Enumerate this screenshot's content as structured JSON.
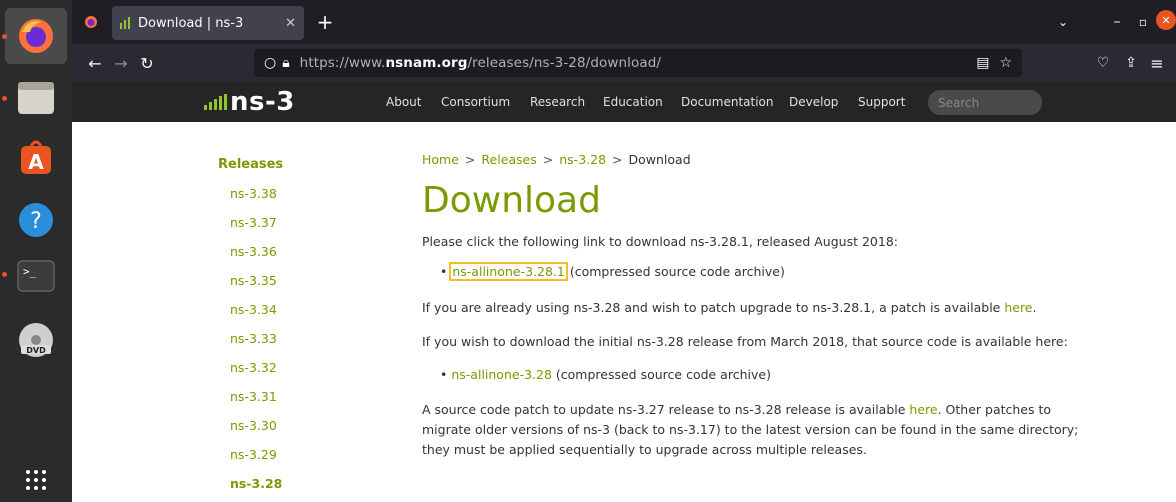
{
  "browser": {
    "tab_title": "Download | ns-3",
    "url_prefix": "https://www.",
    "url_domain": "nsnam.org",
    "url_path": "/releases/ns-3-28/download/"
  },
  "site": {
    "logo_text": "ns-3",
    "nav": [
      "About",
      "Consortium",
      "Research",
      "Education",
      "Documentation",
      "Develop",
      "Support"
    ],
    "search_placeholder": "Search"
  },
  "sidebar": {
    "heading": "Releases",
    "items": [
      "ns-3.38",
      "ns-3.37",
      "ns-3.36",
      "ns-3.35",
      "ns-3.34",
      "ns-3.33",
      "ns-3.32",
      "ns-3.31",
      "ns-3.30",
      "ns-3.29",
      "ns-3.28"
    ]
  },
  "breadcrumb": {
    "home": "Home",
    "releases": "Releases",
    "version": "ns-3.28",
    "current": "Download",
    "separator": ">"
  },
  "main": {
    "title": "Download",
    "intro": "Please click the following link to download ns-3.28.1, released August 2018:",
    "link1_text": "ns-allinone-3.28.1",
    "link1_suffix": " (compressed source code archive)",
    "patch_text": "If you are already using ns-3.28 and wish to patch upgrade to ns-3.28.1, a patch is available ",
    "here": "here",
    "period": ".",
    "initial_text": "If you wish to download the initial ns-3.28 release from March 2018, that source code is available here:",
    "link2_text": "ns-allinone-3.28",
    "link2_suffix": " (compressed source code archive)",
    "para_line1_a": "A source code patch to update ns-3.27 release to ns-3.28 release is available ",
    "para_line1_b": ". Other patches to",
    "para_line2": "migrate older versions of ns-3 (back to ns-3.17) to the latest version can be found in the same directory;",
    "para_line3": "they must be applied sequentially to upgrade across multiple releases."
  },
  "colors": {
    "accent_green": "#7a9a00",
    "header_bg": "#252525",
    "highlight": "#f0c020"
  }
}
